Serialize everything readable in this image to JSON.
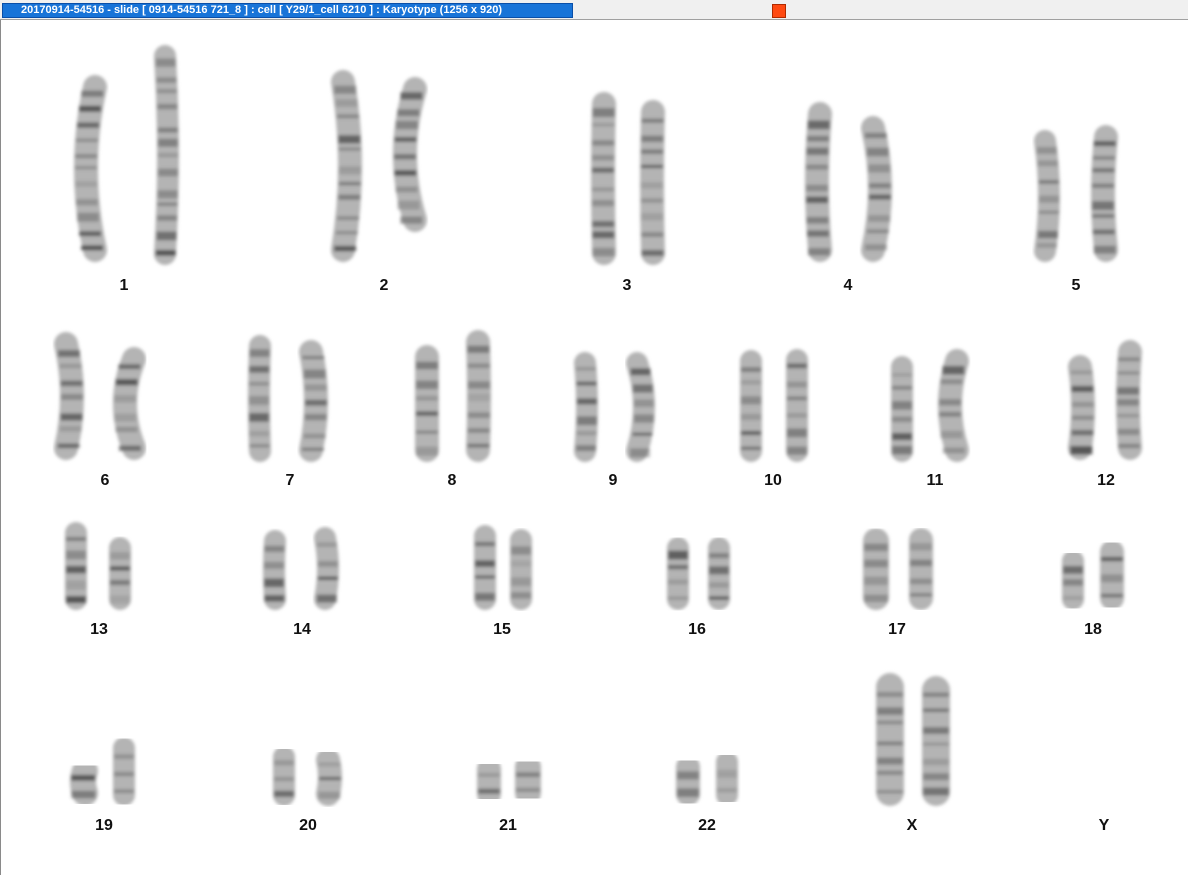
{
  "window": {
    "title": "20170914-54516 - slide [ 0914-54516 721_8 ] : cell [ Y29/1_cell 6210 ] : Karyotype  (1256 x 920)"
  },
  "icons": {
    "close": "close-icon"
  },
  "colors": {
    "titlebar_active": "#1874d8",
    "close_button": "#ff4a12",
    "chromosome": "#9c9c9c"
  },
  "karyotype": {
    "labels": [
      "1",
      "2",
      "3",
      "4",
      "5",
      "6",
      "7",
      "8",
      "9",
      "10",
      "11",
      "12",
      "13",
      "14",
      "15",
      "16",
      "17",
      "18",
      "19",
      "20",
      "21",
      "22",
      "X",
      "Y"
    ]
  }
}
